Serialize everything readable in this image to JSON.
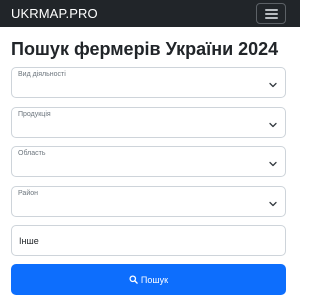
{
  "navbar": {
    "brand": "UKRMAP.PRO",
    "menu_icon": "hamburger-icon"
  },
  "page": {
    "title": "Пошук фермерів України 2024"
  },
  "form": {
    "activity_label": "Вид діяльності",
    "products_label": "Продукція",
    "region_label": "Область",
    "district_label": "Район",
    "other_value": "Інше",
    "search_label": "Пошук",
    "search_icon": "search-icon",
    "chevron_icon": "chevron-down-icon"
  },
  "colors": {
    "navbar": "#212529",
    "primary": "#0d6efd",
    "border": "#ced4da",
    "muted": "#6c757d"
  }
}
